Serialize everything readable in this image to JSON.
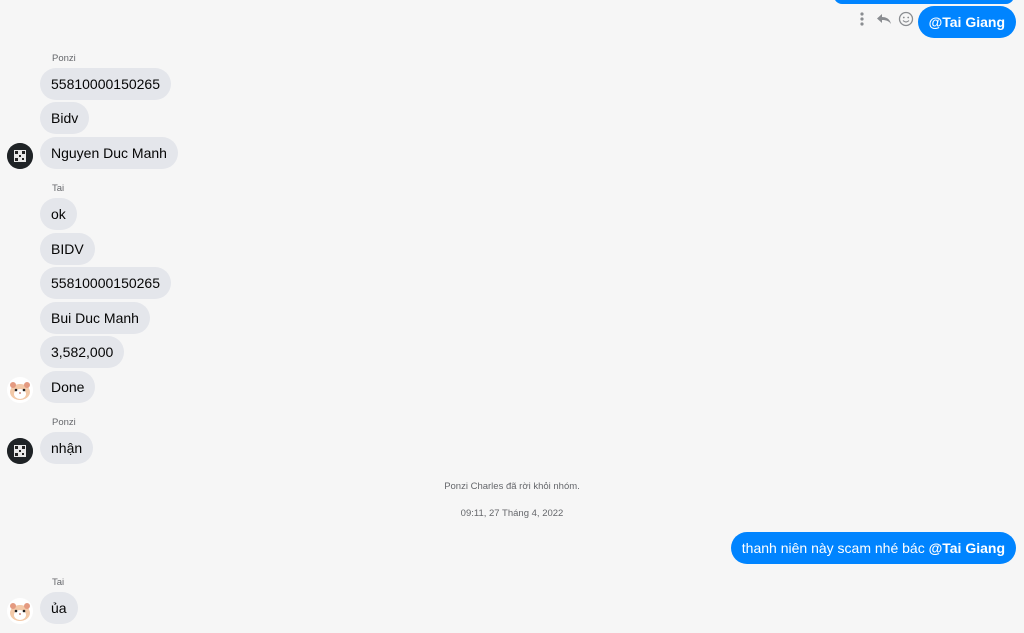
{
  "messages": {
    "top_outgoing_mention": "@Tai Giang",
    "ponzi_group_1": {
      "sender": "Ponzi",
      "lines": [
        "55810000150265",
        "Bidv",
        "Nguyen Duc Manh"
      ]
    },
    "tai_group_1": {
      "sender": "Tai",
      "lines": [
        "ok",
        "BIDV",
        "55810000150265",
        "Bui Duc Manh",
        "3,582,000",
        "Done"
      ]
    },
    "ponzi_group_2": {
      "sender": "Ponzi",
      "lines": [
        "nhận"
      ]
    },
    "system_notice": "Ponzi Charles đã rời khỏi nhóm.",
    "timestamp": "09:11, 27 Tháng 4, 2022",
    "outgoing_2": {
      "text": "thanh niên này scam nhé bác ",
      "mention": "@Tai Giang"
    },
    "tai_group_2": {
      "sender": "Tai",
      "lines": [
        "ủa"
      ]
    }
  },
  "icons": {
    "more": "more-vertical-icon",
    "reply": "reply-icon",
    "react": "smiley-icon"
  },
  "colors": {
    "outgoing_bubble": "#0084ff",
    "incoming_bubble": "#e4e6eb",
    "background": "#f6f6f6"
  }
}
